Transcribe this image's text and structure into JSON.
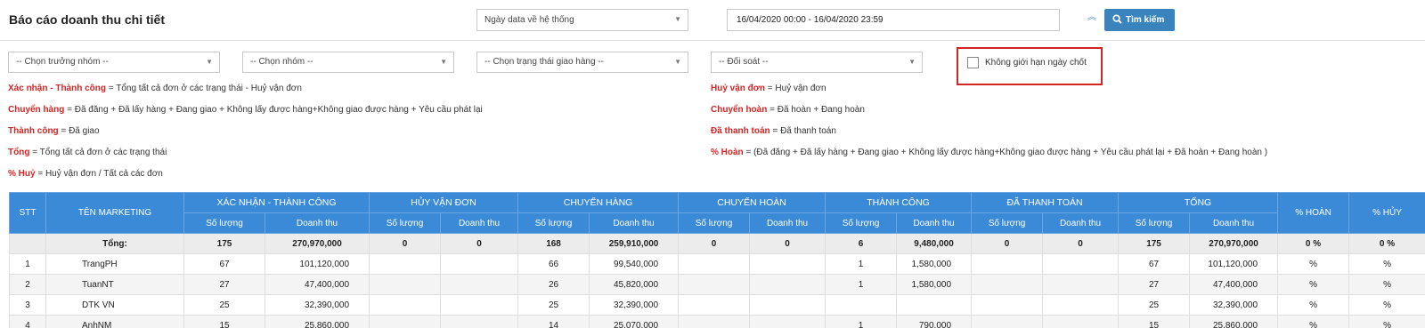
{
  "header": {
    "title": "Báo cáo doanh thu chi tiết",
    "date_type_select": "Ngày data về hệ thống",
    "date_range": "16/04/2020 00:00 - 16/04/2020 23:59",
    "search_label": "Tìm kiếm"
  },
  "filters": {
    "group_leader": "-- Chọn trưởng nhóm --",
    "group": "-- Chọn nhóm --",
    "delivery_status": "-- Chọn trạng thái giao hàng --",
    "reconcile": "-- Đối soát --",
    "no_limit_label": "Không giới hạn ngày chốt",
    "no_limit_checked": false
  },
  "legend": {
    "left": [
      {
        "key": "Xác nhận - Thành công",
        "text": " = Tổng tất cả đơn ở các trạng thái - Huỷ vận đơn"
      },
      {
        "key": "Chuyển hàng",
        "text": " = Đã đăng + Đã lấy hàng + Đang giao + Không lấy được hàng+Không giao được hàng + Yêu cầu phát lại"
      },
      {
        "key": "Thành công",
        "text": " = Đã giao"
      },
      {
        "key": "Tổng",
        "text": " = Tổng tất cả đơn ở các trạng thái"
      },
      {
        "key": "% Huỷ",
        "text": " = Huỷ vận đơn / Tất cả các đơn"
      }
    ],
    "right": [
      {
        "key": "Huỷ vận đơn",
        "text": " = Huỷ vận đơn"
      },
      {
        "key": "Chuyển hoàn",
        "text": " = Đã hoàn + Đang hoàn"
      },
      {
        "key": "Đã thanh toán",
        "text": " = Đã thanh toán"
      },
      {
        "key": "% Hoàn",
        "text": " = (Đã đăng + Đã lấy hàng + Đang giao + Không lấy được hàng+Không giao được hàng + Yêu cầu phát lại + Đã hoàn + Đang hoàn )"
      }
    ]
  },
  "table": {
    "col_stt": "STT",
    "col_name": "TÊN MARKETING",
    "groups": [
      "XÁC NHẬN - THÀNH CÔNG",
      "HỦY VẬN ĐƠN",
      "CHUYỂN HÀNG",
      "CHUYỂN HOÀN",
      "THÀNH CÔNG",
      "ĐÃ THANH TOÁN",
      "TỔNG"
    ],
    "sub_qty": "Số lượng",
    "sub_rev": "Doanh thu",
    "col_pct_return": "% HOÀN",
    "col_pct_cancel": "% HỦY",
    "total_row": [
      "",
      "Tổng:",
      "175",
      "270,970,000",
      "0",
      "0",
      "168",
      "259,910,000",
      "0",
      "0",
      "6",
      "9,480,000",
      "0",
      "0",
      "175",
      "270,970,000",
      "0 %",
      "0 %"
    ],
    "rows": [
      [
        "1",
        "TrangPH",
        "67",
        "101,120,000",
        "",
        "",
        "66",
        "99,540,000",
        "",
        "",
        "1",
        "1,580,000",
        "",
        "",
        "67",
        "101,120,000",
        "%",
        "%"
      ],
      [
        "2",
        "TuanNT",
        "27",
        "47,400,000",
        "",
        "",
        "26",
        "45,820,000",
        "",
        "",
        "1",
        "1,580,000",
        "",
        "",
        "27",
        "47,400,000",
        "%",
        "%"
      ],
      [
        "3",
        "DTK VN",
        "25",
        "32,390,000",
        "",
        "",
        "25",
        "32,390,000",
        "",
        "",
        "",
        "",
        "",
        "",
        "25",
        "32,390,000",
        "%",
        "%"
      ],
      [
        "4",
        "AnhNM",
        "15",
        "25,860,000",
        "",
        "",
        "14",
        "25,070,000",
        "",
        "",
        "1",
        "790,000",
        "",
        "",
        "15",
        "25,860,000",
        "%",
        "%"
      ]
    ]
  }
}
